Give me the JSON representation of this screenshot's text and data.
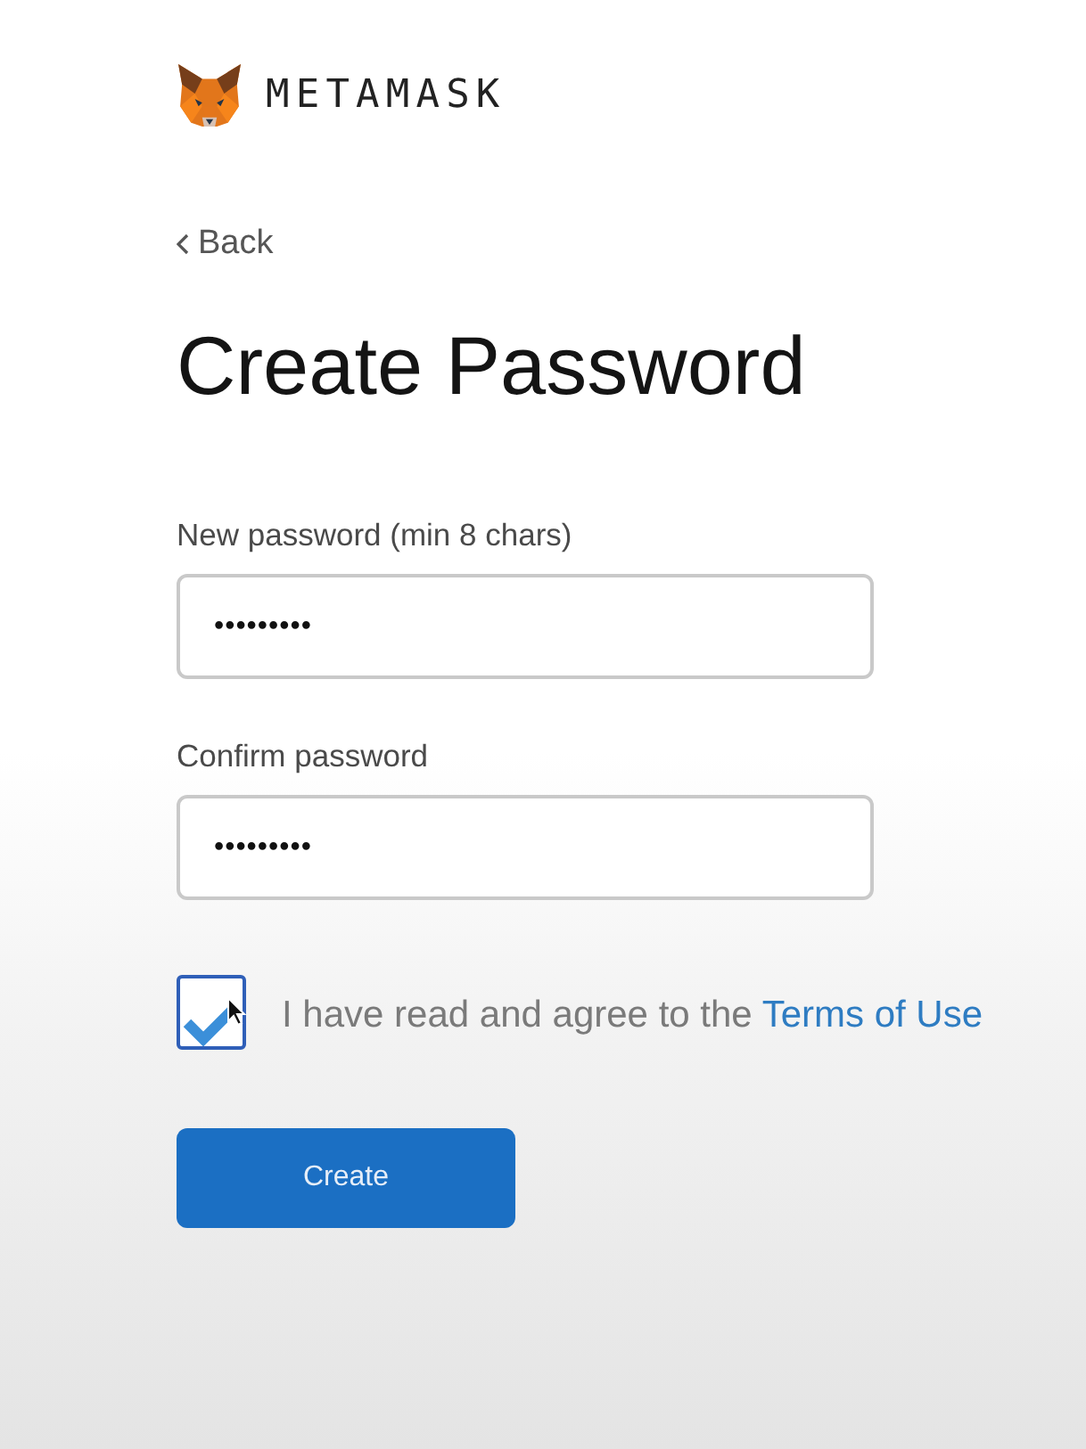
{
  "logo": {
    "wordmark": "METAMASK"
  },
  "back_link": {
    "label": "Back"
  },
  "title": "Create Password",
  "fields": [
    {
      "label": "New password (min 8 chars)",
      "value": "•••••••••"
    },
    {
      "label": "Confirm password",
      "value": "•••••••••"
    }
  ],
  "terms": {
    "checked": true,
    "text": "I have read and agree to the ",
    "link": "Terms of Use"
  },
  "create_button": {
    "label": "Create"
  }
}
